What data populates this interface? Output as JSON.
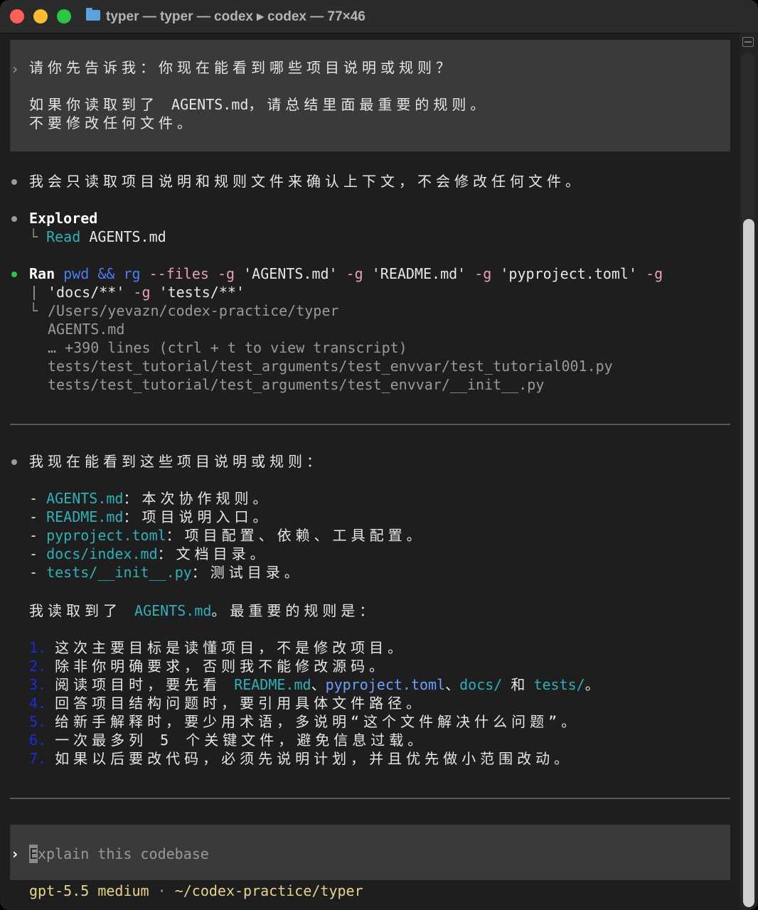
{
  "window": {
    "title": "typer — typer — codex ▸ codex — 77×46"
  },
  "prompt": {
    "chevron": "›",
    "line1": "请你先告诉我：你现在能看到哪些项目说明或规则？",
    "line2": "如果你读取到了 AGENTS.md，请总结里面最重要的规则。",
    "line3": "不要修改任何文件。"
  },
  "reply1": "我会只读取项目说明和规则文件来确认上下文，不会修改任何文件。",
  "explored": {
    "title": "Explored",
    "tree": "└",
    "verb": "Read",
    "file": "AGENTS.md"
  },
  "ran": {
    "label": "Ran",
    "cmd1": "pwd",
    "op": "&&",
    "cmd2": "rg",
    "flag_files": "--files",
    "g": "-g",
    "p1": "'AGENTS.md'",
    "p2": "'README.md'",
    "p3": "'pyproject.toml'",
    "p4": "'docs/**'",
    "p5": "'tests/**'",
    "output": [
      "/Users/yevazn/codex-practice/typer",
      "AGENTS.md",
      "… +390 lines (ctrl + t to view transcript)",
      "tests/test_tutorial/test_arguments/test_envvar/test_tutorial001.py",
      "tests/test_tutorial/test_arguments/test_envvar/__init__.py"
    ]
  },
  "answer": {
    "intro": "我现在能看到这些项目说明或规则：",
    "items": [
      {
        "dash": "-",
        "file": "AGENTS.md",
        "desc": "：本次协作规则。"
      },
      {
        "dash": "-",
        "file": "README.md",
        "desc": "：项目说明入口。"
      },
      {
        "dash": "-",
        "file": "pyproject.toml",
        "desc": "：项目配置、依赖、工具配置。"
      },
      {
        "dash": "-",
        "file": "docs/index.md",
        "desc": "：文档目录。"
      },
      {
        "dash": "-",
        "file": "tests/__init__.py",
        "desc": "：测试目录。"
      }
    ],
    "read_prefix": "我读取到了 ",
    "read_file": "AGENTS.md",
    "read_suffix": "。最重要的规则是：",
    "rules": [
      {
        "n": "1.",
        "text": "这次主要目标是读懂项目，不是修改项目。"
      },
      {
        "n": "2.",
        "text": "除非你明确要求，否则我不能修改源码。"
      },
      {
        "n": "3.",
        "pre": "阅读项目时，要先看 ",
        "f1": "README.md",
        "s1": "、",
        "f2": "pyproject.toml",
        "s2": "、",
        "f3": "docs/",
        "s3": " 和 ",
        "f4": "tests/",
        "s4": "。"
      },
      {
        "n": "4.",
        "text": "回答项目结构问题时，要引用具体文件路径。"
      },
      {
        "n": "5.",
        "text": "给新手解释时，要少用术语，多说明“这个文件解决什么问题”。"
      },
      {
        "n": "6.",
        "text": "一次最多列 5 个关键文件，避免信息过载。"
      },
      {
        "n": "7.",
        "text": "如果以后要改代码，必须先说明计划，并且优先做小范围改动。"
      }
    ]
  },
  "input": {
    "chevron": "›",
    "cursor_char": "E",
    "placeholder": "xplain this codebase"
  },
  "status": {
    "model": "gpt-5.5 medium",
    "sep": "·",
    "path": "~/codex-practice/typer"
  },
  "colors": {
    "accent_cyan": "#2fb0b8",
    "blue": "#4c7ef0",
    "pink": "#e8a0b4",
    "number_blue": "#1d2ad8",
    "green_dot": "#28c840"
  }
}
